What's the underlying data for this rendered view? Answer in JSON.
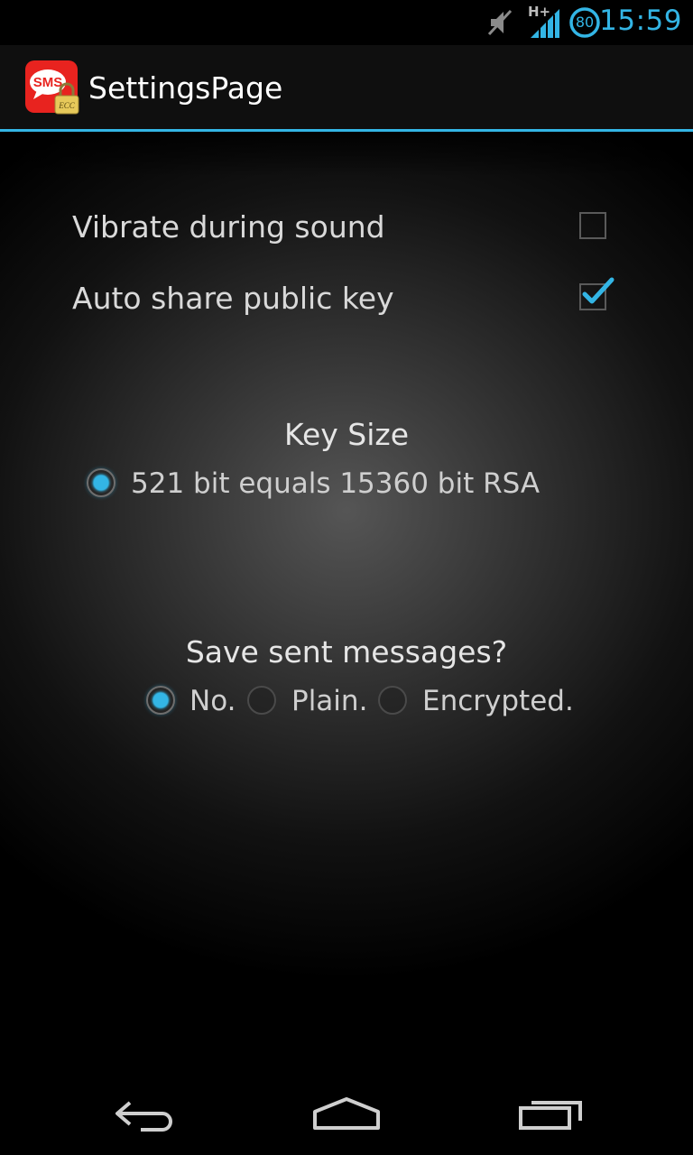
{
  "status_bar": {
    "time": "15:59",
    "network_type": "H+",
    "battery_level": "80",
    "icons": [
      "mute-icon",
      "signal-icon",
      "battery-icon"
    ]
  },
  "action_bar": {
    "title": "SettingsPage",
    "app_icon": "sms-ecc-app-icon",
    "app_icon_text": "SMS",
    "app_icon_badge": "ECC"
  },
  "settings": {
    "vibrate": {
      "label": "Vibrate during sound",
      "checked": false
    },
    "auto_share": {
      "label": "Auto share public key",
      "checked": true
    }
  },
  "key_size": {
    "title": "Key Size",
    "options": [
      {
        "label": "521 bit equals 15360 bit RSA",
        "selected": true
      }
    ]
  },
  "save_sent": {
    "title": "Save sent messages?",
    "options": [
      {
        "label": "No.",
        "selected": true
      },
      {
        "label": "Plain.",
        "selected": false
      },
      {
        "label": "Encrypted.",
        "selected": false
      }
    ]
  },
  "nav_bar": {
    "buttons": [
      "back-icon",
      "home-icon",
      "recents-icon"
    ]
  },
  "colors": {
    "accent": "#33b5e5",
    "text_primary": "#ffffff",
    "text_secondary": "#d9d9d9",
    "app_icon_red": "#e8231f"
  }
}
